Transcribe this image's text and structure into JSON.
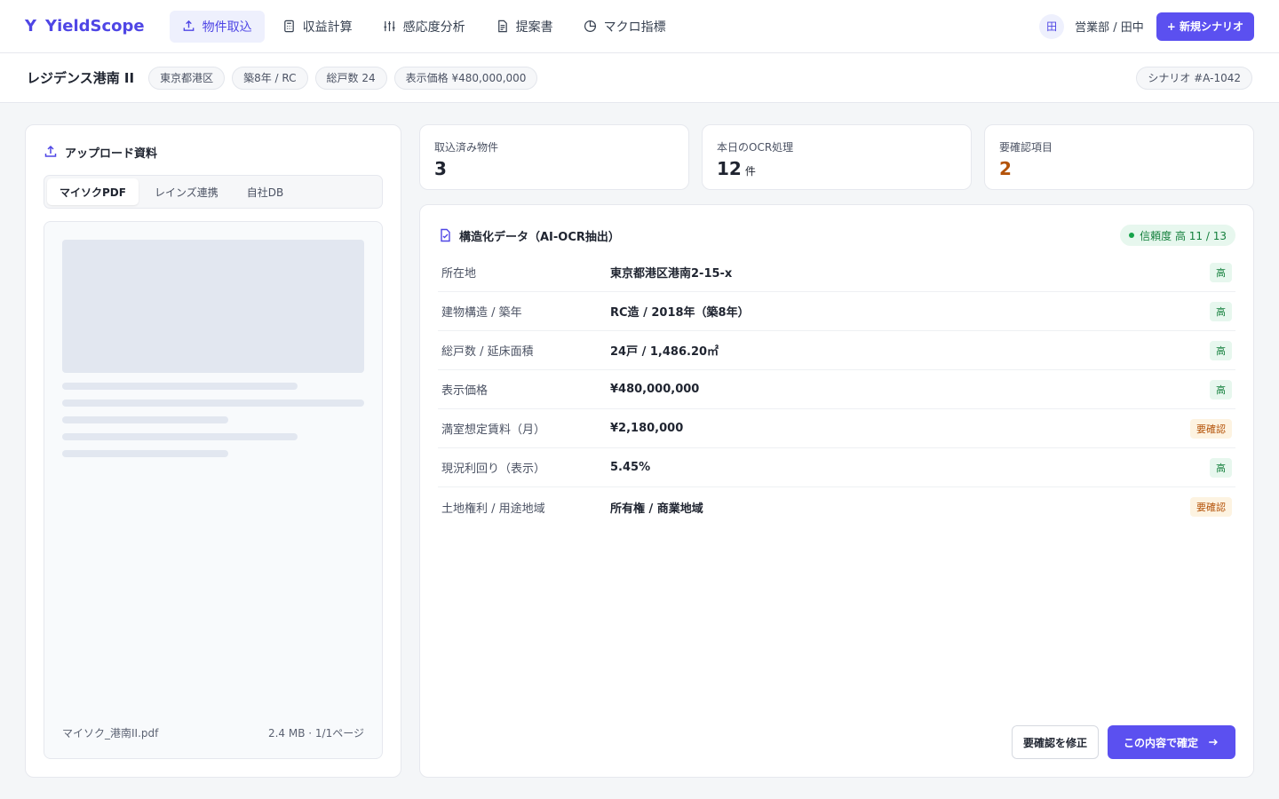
{
  "app": {
    "logo_mark": "Y",
    "name": "YieldScope"
  },
  "nav": {
    "items": [
      {
        "label": "物件取込",
        "icon": "upload-icon"
      },
      {
        "label": "収益計算",
        "icon": "calculator-icon"
      },
      {
        "label": "感応度分析",
        "icon": "sliders-icon"
      },
      {
        "label": "提案書",
        "icon": "document-icon"
      },
      {
        "label": "マクロ指標",
        "icon": "pie-chart-icon"
      }
    ],
    "active_index": 0
  },
  "user": {
    "avatar_text": "田",
    "name": "営業部 / 田中"
  },
  "new_scenario_label": "+ 新規シナリオ",
  "property": {
    "title": "レジデンス港南 II",
    "chips": [
      "東京都港区",
      "築8年 / RC",
      "総戸数 24",
      "表示価格 ¥480,000,000"
    ],
    "scenario": "シナリオ #A-1042"
  },
  "upload": {
    "title": "アップロード資料",
    "tabs": [
      "マイソクPDF",
      "レインズ連携",
      "自社DB"
    ],
    "active_tab": 0,
    "file_name": "マイソク_港南II.pdf",
    "file_meta": "2.4 MB · 1/1ページ"
  },
  "stats": [
    {
      "label": "取込済み物件",
      "value": "3",
      "unit": ""
    },
    {
      "label": "本日のOCR処理",
      "value": "12",
      "unit": "件"
    },
    {
      "label": "要確認項目",
      "value": "2",
      "unit": ""
    }
  ],
  "structured": {
    "title": "構造化データ（AI-OCR抽出）",
    "confidence": "信頼度 高 11 / 13",
    "rows": [
      {
        "label": "所在地",
        "value": "東京都港区港南2-15-x",
        "badge": "高",
        "level": "high"
      },
      {
        "label": "建物構造 / 築年",
        "value": "RC造 / 2018年（築8年）",
        "badge": "高",
        "level": "high"
      },
      {
        "label": "総戸数 / 延床面積",
        "value": "24戸 / 1,486.20㎡",
        "badge": "高",
        "level": "high"
      },
      {
        "label": "表示価格",
        "value": "¥480,000,000",
        "badge": "高",
        "level": "high"
      },
      {
        "label": "満室想定賃料（月）",
        "value": "¥2,180,000",
        "badge": "要確認",
        "level": "check"
      },
      {
        "label": "現況利回り（表示）",
        "value": "5.45%",
        "badge": "高",
        "level": "high"
      },
      {
        "label": "土地権利 / 用途地域",
        "value": "所有権 / 商業地域",
        "badge": "要確認",
        "level": "check"
      }
    ],
    "fix_label": "要確認を修正",
    "confirm_label": "この内容で確定"
  },
  "colors": {
    "accent": "#5b50f0",
    "high": "#15803d",
    "warn": "#b45309"
  }
}
